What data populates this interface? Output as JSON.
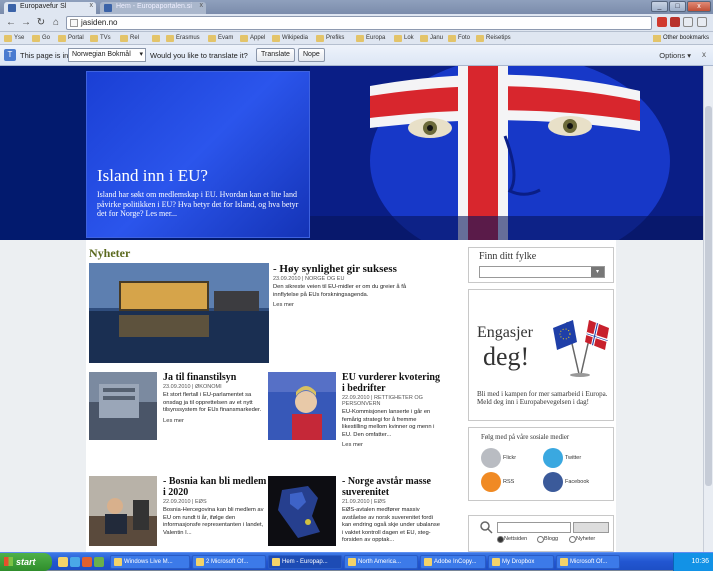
{
  "browser": {
    "tabs": [
      {
        "label": "Europavefur Sl",
        "active": true
      },
      {
        "label": "Hem - Europaportalen.si",
        "active": false
      }
    ],
    "address": "jasiden.no",
    "window_controls": {
      "minimize": "_",
      "maximize": "□",
      "close": "x"
    }
  },
  "bookmarks": {
    "items": [
      "Yse",
      "Go",
      "Portal",
      "TVs",
      "Rel",
      "",
      "Erasmus",
      "Evam",
      "Appel",
      "Wikipedia",
      "Prefiks",
      "Europa",
      "Lok",
      "Janu",
      "Foto",
      "Reisetips"
    ],
    "other": "Other bookmarks"
  },
  "translate_bar": {
    "prefix": "This page is in",
    "language": "Norwegian Bokmål",
    "question": "Would you like to translate it?",
    "translate_button": "Translate",
    "nope_button": "Nope",
    "options": "Options ▾",
    "close": "x"
  },
  "hero": {
    "title": "Island inn i EU?",
    "text": "Island har søkt om medlemskap i EU. Hvordan kan et lite land påvirke politikken i EU? Hva betyr det for Island, og hva betyr det for Norge? Les mer..."
  },
  "news": {
    "heading": "Nyheter",
    "featured": {
      "title": "- Høy synlighet gir suksess",
      "meta": "23.09.2010 | NORGE OG EU",
      "body": "Den sikreste veien til EU-midler er om du greier å få innflytelse på EUs forskningsagenda.",
      "more": "Les mer"
    },
    "articles": [
      {
        "title": "Ja til finanstilsyn",
        "meta": "23.09.2010 | ØKONOMI",
        "body": "Et stort flertall i EU-parlamentet sa onsdag ja til opprettelsen av et nytt tilsynssystem for EUs finansmarkeder.",
        "more": "Les mer"
      },
      {
        "title": "EU vurderer kvotering i bedrifter",
        "meta": "22.09.2010 | RETTIGHETER OG PERSONVERN",
        "body": "EU-Kommisjonen lanserte i går en femårig strategi for å fremme likestilling mellom kvinner og menn i EU. Den omfatter...",
        "more": "Les mer"
      },
      {
        "title": "- Bosnia kan bli medlem i 2020",
        "meta": "22.09.2010 | EØS",
        "body": "Bosnia-Hercegovina kan bli medlem av EU om rundt ti år, ifølge den informasjonsfe representanten i landet, Valentin I..."
      },
      {
        "title": "- Norge avstår masse suverenitet",
        "meta": "21.09.2010 | EØS",
        "body": "EØS-avtalen medfører massiv avståelse av norsk suverenitet fordi kan endring også skje under ubalanse i vaktet kontroll dagen et EU, steg-forsiden av opptak..."
      }
    ]
  },
  "sidebar": {
    "county": {
      "title": "Finn ditt fylke",
      "arrow": "▾"
    },
    "engage": {
      "title_line1": "Engasjer",
      "title_line2": "deg!",
      "text": "Bli med i kampen for mer samarbeid i Europa. Meld deg inn i Europabevegelsen i dag!"
    },
    "social": {
      "title": "Følg med på våre sosiale medier",
      "items": [
        {
          "label": "Flickr",
          "icon": "flickr-icon",
          "color": "#b9bcc2"
        },
        {
          "label": "Twitter",
          "icon": "twitter-icon",
          "color": "#3aa8e0"
        },
        {
          "label": "RSS",
          "icon": "rss-icon",
          "color": "#f08a24"
        },
        {
          "label": "Facebook",
          "icon": "facebook-icon",
          "color": "#3b5a9a"
        }
      ]
    },
    "search": {
      "radios": [
        {
          "label": "Nettsiden",
          "checked": true
        },
        {
          "label": "Blogg",
          "checked": false
        },
        {
          "label": "Nyheter",
          "checked": false
        }
      ]
    }
  },
  "taskbar": {
    "start": "start",
    "tasks": [
      {
        "label": "Windows Live M...",
        "active": false
      },
      {
        "label": "2 Microsoft Of...",
        "active": false
      },
      {
        "label": "Hem - Europap...",
        "active": true
      },
      {
        "label": "North America...",
        "active": false
      },
      {
        "label": "Adobe InCopy...",
        "active": false
      },
      {
        "label": "My Dropbox",
        "active": false
      },
      {
        "label": "Microsoft Of...",
        "active": false
      }
    ],
    "clock": "10:36"
  },
  "colors": {
    "hero_bg": "#021a6e",
    "heading": "#5b6a1e",
    "taskbar": "#2256d1"
  }
}
